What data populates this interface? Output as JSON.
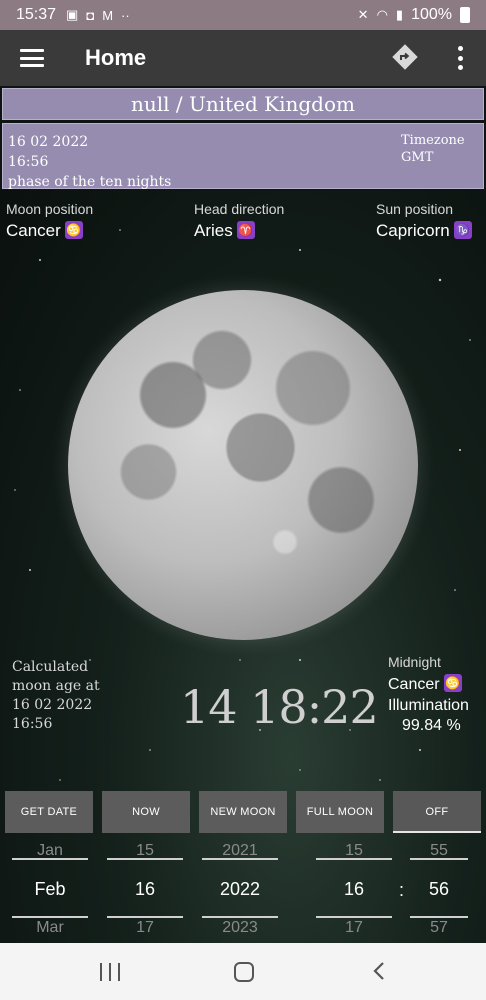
{
  "status_bar": {
    "time": "15:37",
    "battery": "100%",
    "left_icons": [
      "image-icon",
      "shopping-bag-icon",
      "gmail-icon",
      "more-dots-icon"
    ],
    "right_icons": [
      "mute-icon",
      "wifi-icon",
      "signal-icon",
      "battery-icon"
    ]
  },
  "appbar": {
    "title": "Home"
  },
  "location": "null / United Kingdom",
  "info": {
    "date": "16 02 2022",
    "time": "16:56",
    "phase": "phase of the ten nights",
    "timezone_label": "Timezone",
    "timezone": "GMT"
  },
  "positions": {
    "moon_label": "Moon position",
    "moon_value": "Cancer",
    "moon_symbol": "♋",
    "head_label": "Head direction",
    "head_value": "Aries",
    "head_symbol": "♈",
    "sun_label": "Sun position",
    "sun_value": "Capricorn",
    "sun_symbol": "♑"
  },
  "calc": {
    "line1": "Calculated",
    "line2": "moon age at",
    "line3": "16 02 2022",
    "line4": "16:56"
  },
  "moon_age": "14 18:22",
  "midnight": {
    "label": "Midnight",
    "sign": "Cancer",
    "sign_symbol": "♋",
    "illum_label": "Illumination",
    "illum_value": "99.84 %"
  },
  "buttons": {
    "get_date": "GET DATE",
    "now": "NOW",
    "new_moon": "NEW MOON",
    "full_moon": "FULL MOON",
    "off": "OFF"
  },
  "pickers": {
    "month": {
      "prev": "Jan",
      "cur": "Feb",
      "next": "Mar"
    },
    "day": {
      "prev": "15",
      "cur": "16",
      "next": "17"
    },
    "year": {
      "prev": "2021",
      "cur": "2022",
      "next": "2023"
    },
    "hour": {
      "prev": "15",
      "cur": "16",
      "next": "17"
    },
    "minute": {
      "prev": "55",
      "cur": "56",
      "next": "57"
    },
    "separator": ":"
  },
  "colors": {
    "status_bar": "#8d7b83",
    "appbar": "#3a3a3a",
    "info_bg": "#958cb0",
    "zodiac_badge": "#8a3fc8",
    "button_bg": "#5c5c5c"
  }
}
